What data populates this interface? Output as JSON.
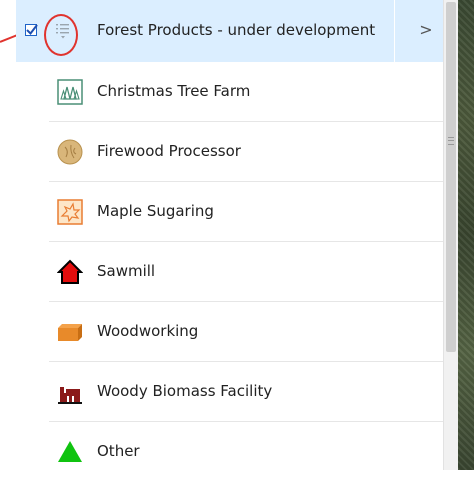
{
  "header": {
    "title": "Forest Products - under development",
    "checked": true,
    "chevron": ">"
  },
  "items": [
    {
      "label": "Christmas Tree Farm",
      "icon": "christmas-tree-farm-icon",
      "color": "#4a8f77"
    },
    {
      "label": "Firewood Processor",
      "icon": "firewood-icon",
      "color": "#d9b67a"
    },
    {
      "label": "Maple Sugaring",
      "icon": "maple-leaf-icon",
      "color": "#e97d32"
    },
    {
      "label": "Sawmill",
      "icon": "house-icon",
      "color": "#e40d0d"
    },
    {
      "label": "Woodworking",
      "icon": "box-icon",
      "color": "#e88a2a"
    },
    {
      "label": "Woody Biomass Facility",
      "icon": "factory-icon",
      "color": "#8b1a1a"
    },
    {
      "label": "Other",
      "icon": "triangle-icon",
      "color": "#10c310"
    }
  ],
  "colors": {
    "header_bg": "#dbeeff",
    "annotation": "#e0332e"
  }
}
